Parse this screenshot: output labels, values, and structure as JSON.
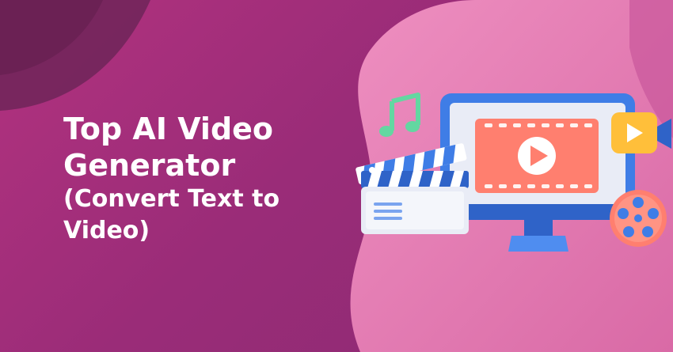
{
  "banner": {
    "title_line1": "Top AI Video",
    "title_line2": "Generator",
    "subtitle": "(Convert Text to Video)"
  },
  "colors": {
    "bg_left": "#b2327f",
    "bg_right": "#8a2a72",
    "blob_pink": "#e57fb1",
    "monitor_blue": "#3f7de6",
    "screen_bg": "#e9ecf6",
    "video_coral": "#ff7f6f",
    "music_green": "#63d7a1",
    "play_yellow": "#ffbf3a"
  },
  "icons": [
    "music-note-icon",
    "clapperboard-icon",
    "monitor-icon",
    "video-player-icon",
    "play-icon",
    "video-camera-icon",
    "film-reel-icon"
  ]
}
